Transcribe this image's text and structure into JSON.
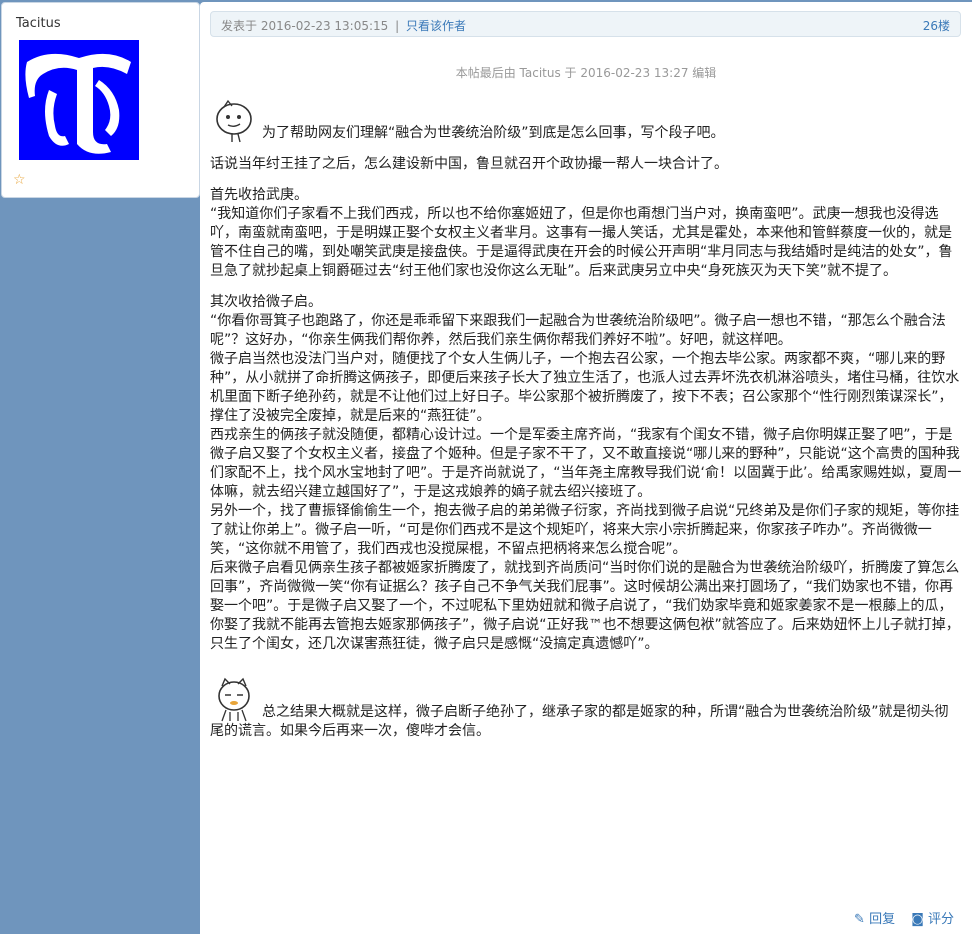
{
  "user": {
    "name": "Tacitus",
    "avatar_glyph": "T",
    "avatar_color": "#0000ff"
  },
  "post": {
    "posted_prefix": "发表于",
    "posted_time": "2016-02-23 13:05:15",
    "separator": "|",
    "author_only_link": "只看该作者",
    "floor": "26楼",
    "edit_note": "本帖最后由 Tacitus 于 2016-02-23 13:27 编辑",
    "intro": "为了帮助网友们理解“融合为世袭统治阶级”到底是怎么回事，写个段子吧。",
    "para1": "话说当年纣王挂了之后，怎么建设新中国，鲁旦就召开个政协撮一帮人一块合计了。",
    "para2_title": "首先收拾武庚。",
    "para2_body": "“我知道你们子家看不上我们西戎，所以也不给你塞姬妞了，但是你也甭想门当户对，换南蛮吧”。武庚一想我也没得选吖，南蛮就南蛮吧，于是明媒正娶个女权主义者芈月。这事有一撮人笑话，尤其是霍处，本来他和管鲜蔡度一伙的，就是管不住自己的嘴，到处嘲笑武庚是接盘侠。于是逼得武庚在开会的时候公开声明“芈月同志与我结婚时是纯洁的处女”，鲁旦急了就抄起桌上铜爵砸过去“纣王他们家也没你这么无耻”。后来武庚另立中央“身死族灭为天下笑”就不提了。",
    "para3_title": "其次收拾微子启。",
    "para3_a": "“你看你哥箕子也跑路了，你还是乖乖留下来跟我们一起融合为世袭统治阶级吧”。微子启一想也不错，“那怎么个融合法呢”？这好办，“你亲生俩我们帮你养，然后我们亲生俩你帮我们养好不啦”。好吧，就这样吧。",
    "para3_b": "微子启当然也没法门当户对，随便找了个女人生俩儿子，一个抱去召公家，一个抱去毕公家。两家都不爽，“哪儿来的野种”，从小就拼了命折腾这俩孩子，即便后来孩子长大了独立生活了，也派人过去弄坏洗衣机淋浴喷头，堵住马桶，往饮水机里面下断子绝孙药，就是不让他们过上好日子。毕公家那个被折腾废了，按下不表；召公家那个“性行刚烈策谋深长”，撑住了没被完全废掉，就是后来的“燕狂徒”。",
    "para3_c": "西戎亲生的俩孩子就没随便，都精心设计过。一个是军委主席齐尚，“我家有个闺女不错，微子启你明媒正娶了吧”，于是微子启又娶了个女权主义者，接盘了个姬种。但是子家不干了，又不敢直接说“哪儿来的野种”，只能说“这个高贵的国种我们家配不上，找个风水宝地封了吧”。于是齐尚就说了，“当年尧主席教导我们说‘俞！以固冀于此’。给禹家赐姓姒，夏周一体嘛，就去绍兴建立越国好了”，于是这戎娘养的嫡子就去绍兴接班了。",
    "para3_d": "另外一个，找了曹振铎偷偷生一个，抱去微子启的弟弟微子衍家，齐尚找到微子启说“兄终弟及是你们子家的规矩，等你挂了就让你弟上”。微子启一听，“可是你们西戎不是这个规矩吖，将来大宗小宗折腾起来，你家孩子咋办”。齐尚微微一笑，“这你就不用管了，我们西戎也没搅屎棍，不留点把柄将来怎么搅合呢”。",
    "para3_e": "后来微子启看见俩亲生孩子都被姬家折腾废了，就找到齐尚质问“当时你们说的是融合为世袭统治阶级吖，折腾废了算怎么回事”，齐尚微微一笑“你有证据么？孩子自己不争气关我们屁事”。这时候胡公满出来打圆场了，“我们妫家也不错，你再娶一个吧”。于是微子启又娶了一个，不过呢私下里妫妞就和微子启说了，“我们妫家毕竟和姬家姜家不是一根藤上的瓜，你娶了我就不能再去管抱去姬家那俩孩子”，微子启说“正好我™也不想要这俩包袱”就答应了。后来妫妞怀上儿子就打掉，只生了个闺女，还几次谋害燕狂徒，微子启只是感慨“没搞定真遗憾吖”。",
    "conclusion": "总之结果大概就是这样，微子启断子绝孙了，继承子家的都是姬家的种，所谓“融合为世袭统治阶级”就是彻头彻尾的谎言。如果今后再来一次，傻哔才会信。"
  },
  "actions": {
    "reply": "回复",
    "rate": "评分"
  },
  "icons": {
    "star": "star-icon",
    "reply": "pencil-icon",
    "rate": "rating-icon",
    "emoticon": "cartoon-face-icon"
  }
}
